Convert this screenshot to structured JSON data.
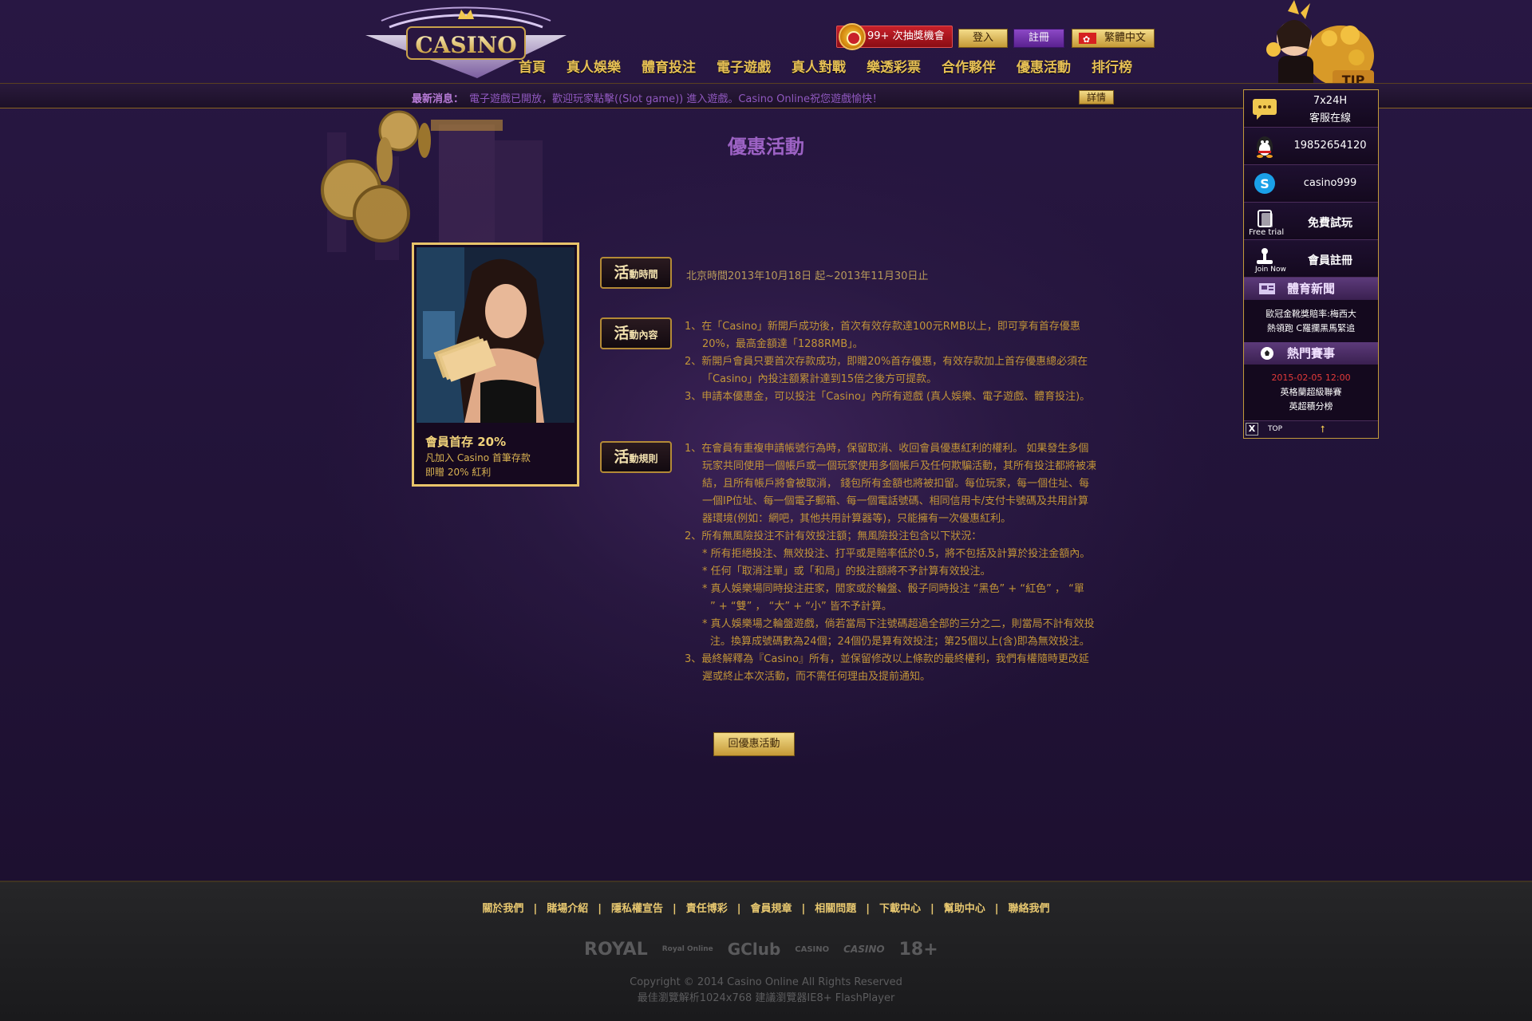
{
  "header": {
    "logo_text": "CASINO",
    "lottery": "99+ 次抽獎機會",
    "login": "登入",
    "register": "註冊",
    "language": "繁體中文",
    "mascot_tip": "TIP"
  },
  "nav": [
    "首頁",
    "真人娛樂",
    "體育投注",
    "電子遊戲",
    "真人對戰",
    "樂透彩票",
    "合作夥伴",
    "優惠活動",
    "排行榜"
  ],
  "news": {
    "label": "最新消息：",
    "text": "電子遊戲已開放，歡迎玩家點擊((Slot game)) 進入遊戲。Casino Online祝您遊戲愉快！",
    "more": "詳情"
  },
  "page_title": "優惠活動",
  "promo": {
    "title": "會員首存 20%",
    "line1": "凡加入 Casino 首筆存款",
    "line2": "即贈 20% 紅利"
  },
  "sections": {
    "time": {
      "big": "活",
      "small": "動時間",
      "text": "北京時間2013年10月18日 起~2013年11月30日止"
    },
    "content": {
      "big": "活",
      "small": "動內容",
      "lines": [
        "1、在「Casino」新開戶成功後，首次有效存款達100元RMB以上，即可享有首存優惠",
        "20%，最高金額達「1288RMB」。",
        "2、新開戶會員只要首次存款成功，即贈20%首存優惠，有效存款加上首存優惠總必須在",
        "「Casino」內投注額累計達到15倍之後方可提款。",
        "3、申請本優惠金，可以投注「Casino」內所有遊戲 (真人娛樂、電子遊戲、體育投注)。"
      ]
    },
    "rules": {
      "big": "活",
      "small": "動規則",
      "lines": [
        "1、在會員有重複申請帳號行為時，保留取消、收回會員優惠紅利的權利。 如果發生多個",
        "玩家共同使用一個帳戶或一個玩家使用多個帳戶及任何欺騙活動，其所有投注都將被凍",
        "結，且所有帳戶將會被取消， 錢包所有金額也將被扣留。每位玩家，每一個住址、每",
        "一個IP位址、每一個電子郵箱、每一個電話號碼、相同信用卡/支付卡號碼及共用計算",
        "器環境(例如：網吧，其他共用計算器等)，只能擁有一次優惠紅利。",
        "2、所有無風險投注不計有效投注額；無風險投注包含以下狀況：",
        "* 所有拒絕投注、無效投注、打平或是賠率低於0.5，將不包括及計算於投注金額內。",
        "* 任何「取消注單」或「和局」的投注額將不予計算有效投注。",
        "* 真人娛樂場同時投注莊家，閒家或於輪盤、骰子同時投注 “黑色” + “紅色” ， “單",
        "” + “雙” ， “大” + “小” 皆不予計算。",
        "* 真人娛樂場之輪盤遊戲，倘若當局下注號碼超過全部的三分之二，則當局不計有效投",
        "注。換算成號碼數為24個；24個仍是算有效投注；第25個以上(含)即為無效投注。",
        "3、最終解釋為『Casino』所有，並保留修改以上條款的最終權利，我們有權隨時更改延",
        "遲或終止本次活動，而不需任何理由及提前通知。"
      ]
    }
  },
  "back_button": "回優惠活動",
  "side_panel": {
    "service_line1": "7x24H",
    "service_line2": "客服在線",
    "qq": "19852654120",
    "skype": "casino999",
    "free_trial_label": "Free trial",
    "free_trial": "免費試玩",
    "join_label": "Join Now",
    "join": "會員註冊",
    "sports_news_title": "體育新聞",
    "sports_news_line1": "歐冠金靴獎賠率:梅西大",
    "sports_news_line2": "熱領跑 C羅攔黑馬緊追",
    "hot_match_title": "熱門賽事",
    "hot_match_time": "2015-02-05 12:00",
    "hot_match_league": "英格蘭超級聯賽",
    "hot_match_item": "英超積分榜",
    "close": "X",
    "top": "TOP"
  },
  "footer": {
    "links": [
      "關於我們",
      "賭場介紹",
      "隱私權宣告",
      "責任博彩",
      "會員規章",
      "相關問題",
      "下載中心",
      "幫助中心",
      "聯絡我們"
    ],
    "partners": [
      "ROYAL",
      "Royal Online",
      "GClub",
      "CASINO",
      "CASINO",
      "18+"
    ],
    "copyright": "Copyright © 2014 Casino Online All Rights Reserved",
    "browser_note": "最佳瀏覽解析1024x768 建議瀏覽器IE8+ FlashPlayer"
  },
  "colors": {
    "background": "#1e1231",
    "gold": "#e9c46a",
    "text_gold": "#c29538",
    "purple_title": "#9c62c4",
    "red_time": "#e43a3a"
  }
}
